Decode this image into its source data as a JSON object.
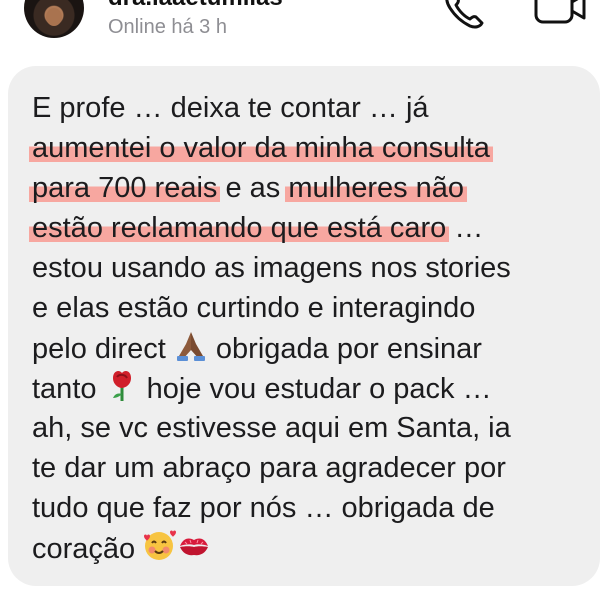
{
  "header": {
    "username": "dra.iaaetumiias",
    "status": "Online há 3 h"
  },
  "icons": {
    "phone": "phone-icon",
    "video": "video-camera-icon",
    "pray": "folded-hands-emoji",
    "rose": "rose-emoji",
    "smile": "smiling-face-with-hearts-emoji",
    "kiss": "kiss-mark-emoji"
  },
  "colors": {
    "bubble": "#efefef",
    "highlight": "#f7a7a0",
    "status_text": "#8e8e93"
  },
  "message": {
    "l1": "E profe … deixa te contar … já",
    "l2": "aumentei o valor da minha consulta",
    "l3a": "para 700 reais",
    "l3b": " e as ",
    "l3c": "mulheres não",
    "l4a": "estão reclamando que está caro",
    "l4b": " …",
    "l5": "estou usando as imagens nos stories",
    "l6": "e elas estão curtindo e interagindo",
    "l7a": "pelo direct ",
    "l7b": " obrigada por ensinar",
    "l8a": "tanto ",
    "l8b": " hoje vou estudar o pack …",
    "l9": "ah, se vc estivesse aqui em Santa, ia",
    "l10": "te dar um abraço para agradecer por",
    "l11": "tudo que faz por nós … obrigada de",
    "l12": "coração "
  }
}
